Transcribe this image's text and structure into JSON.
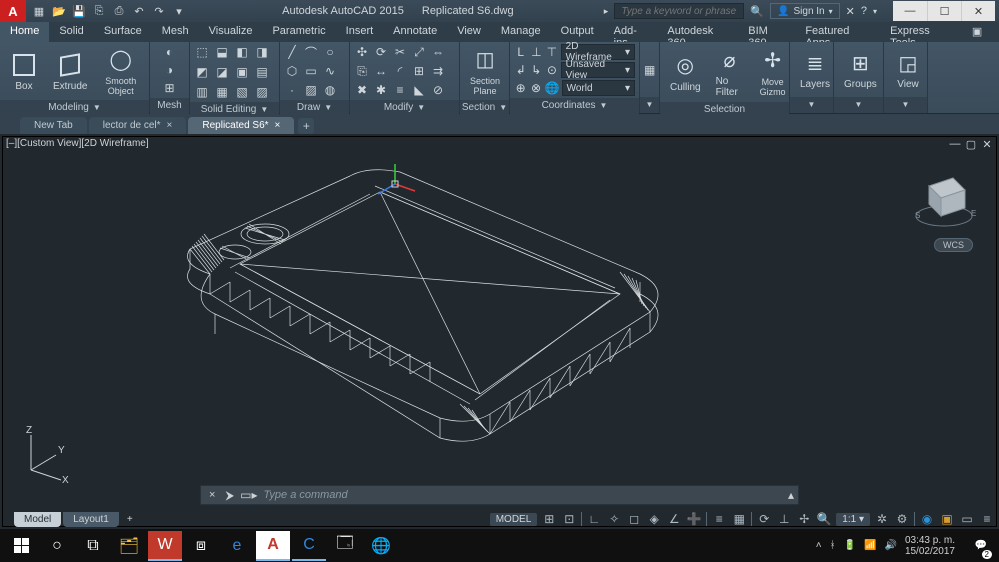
{
  "titlebar": {
    "app_name": "Autodesk AutoCAD 2015",
    "doc_name": "Replicated S6.dwg",
    "search_placeholder": "Type a keyword or phrase",
    "sign_in": "Sign In"
  },
  "ribbon_tabs": [
    "Home",
    "Solid",
    "Surface",
    "Mesh",
    "Visualize",
    "Parametric",
    "Insert",
    "Annotate",
    "View",
    "Manage",
    "Output",
    "Add-ins",
    "Autodesk 360",
    "BIM 360",
    "Featured Apps",
    "Express Tools"
  ],
  "ribbon_active": 0,
  "panels": {
    "modeling": {
      "title": "Modeling",
      "box": "Box",
      "extrude": "Extrude",
      "smooth": "Smooth Object"
    },
    "mesh": {
      "title": "Mesh"
    },
    "solid_editing": {
      "title": "Solid Editing"
    },
    "draw": {
      "title": "Draw"
    },
    "modify": {
      "title": "Modify"
    },
    "section": {
      "title": "Section",
      "btn": "Section Plane"
    },
    "coordinates": {
      "title": "Coordinates",
      "visual_style": "2D Wireframe",
      "view": "Unsaved View",
      "world": "World"
    },
    "selection": {
      "title": "Selection",
      "culling": "Culling",
      "nofilter": "No Filter",
      "gizmo": "Move Gizmo"
    },
    "layers": {
      "title": "Layers"
    },
    "groups": {
      "title": "Groups"
    },
    "view": {
      "title": "View"
    }
  },
  "file_tabs": [
    {
      "label": "New Tab",
      "active": false
    },
    {
      "label": "lector de cel*",
      "active": false
    },
    {
      "label": "Replicated S6*",
      "active": true
    }
  ],
  "viewport": {
    "label": "[–][Custom View][2D Wireframe]",
    "wcs": "WCS",
    "axes": {
      "z": "Z",
      "y": "Y",
      "x": "X"
    }
  },
  "command": {
    "placeholder": "Type a command"
  },
  "layout_tabs": [
    {
      "label": "Model",
      "active": true
    },
    {
      "label": "Layout1",
      "active": false
    }
  ],
  "statusbar": {
    "mode": "MODEL",
    "scale": "1:1"
  },
  "taskbar": {
    "time": "03:43 p. m.",
    "date": "15/02/2017",
    "notif_count": "2"
  }
}
